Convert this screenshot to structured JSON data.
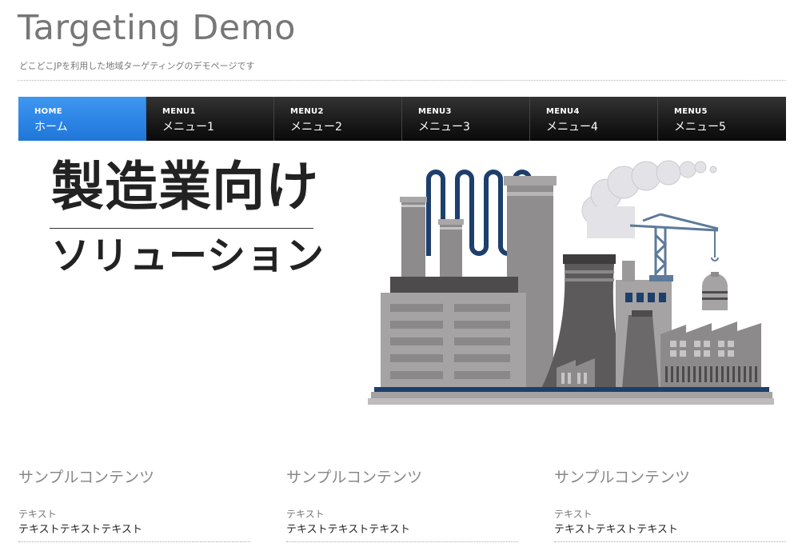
{
  "header": {
    "title": "Targeting Demo",
    "description": "どこどこJPを利用した地域ターゲティングのデモページです"
  },
  "nav": {
    "items": [
      {
        "en": "HOME",
        "ja": "ホーム",
        "active": true
      },
      {
        "en": "MENU1",
        "ja": "メニュー1"
      },
      {
        "en": "MENU2",
        "ja": "メニュー2"
      },
      {
        "en": "MENU3",
        "ja": "メニュー3"
      },
      {
        "en": "MENU4",
        "ja": "メニュー4"
      },
      {
        "en": "MENU5",
        "ja": "メニュー5"
      }
    ]
  },
  "hero": {
    "line1": "製造業向け",
    "line2": "ソリューション"
  },
  "columns": [
    {
      "title": "サンプルコンテンツ",
      "label": "テキスト",
      "text": "テキストテキストテキスト"
    },
    {
      "title": "サンプルコンテンツ",
      "label": "テキスト",
      "text": "テキストテキストテキスト"
    },
    {
      "title": "サンプルコンテンツ",
      "label": "テキスト",
      "text": "テキストテキストテキスト"
    }
  ],
  "colors": {
    "nav_active": "#2c85e6",
    "nav_bg": "#1b1b1b",
    "factory_blue": "#1d3f6b",
    "factory_gray": "#8f8d8d"
  },
  "icons": {
    "hero_image": "factory-illustration"
  }
}
